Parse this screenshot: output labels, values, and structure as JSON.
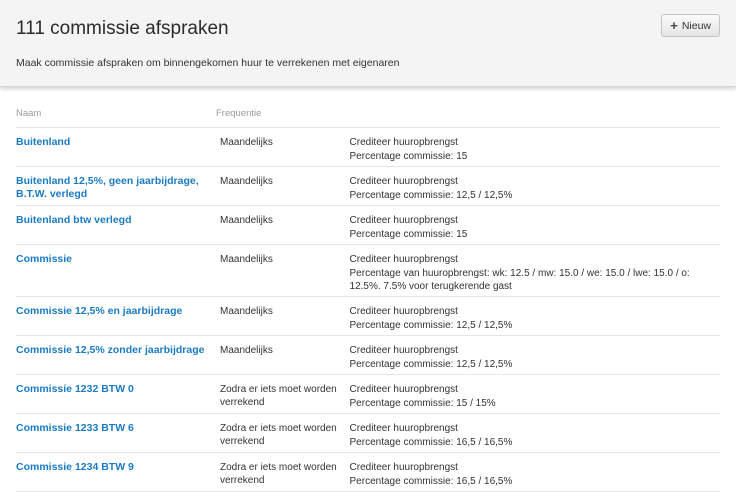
{
  "header": {
    "title": "111 commissie afspraken",
    "subtitle": "Maak commissie afspraken om binnengekomen huur te verrekenen met eigenaren",
    "new_button": {
      "icon": "plus-icon",
      "label": "Nieuw"
    }
  },
  "table": {
    "columns": [
      "Naam",
      "Frequentie",
      ""
    ],
    "rows": [
      {
        "name": "Buitenland",
        "frequency": "Maandelijks",
        "line1": "Crediteer huuropbrengst",
        "line2": "Percentage commissie: 15"
      },
      {
        "name": "Buitenland 12,5%, geen jaarbijdrage, B.T.W. verlegd",
        "frequency": "Maandelijks",
        "line1": "Crediteer huuropbrengst",
        "line2": "Percentage commissie: 12,5 / 12,5%"
      },
      {
        "name": "Buitenland btw verlegd",
        "frequency": "Maandelijks",
        "line1": "Crediteer huuropbrengst",
        "line2": "Percentage commissie: 15"
      },
      {
        "name": "Commissie",
        "frequency": "Maandelijks",
        "line1": "Crediteer huuropbrengst",
        "line2": "Percentage van huuropbrengst: wk: 12.5 / mw: 15.0 / we: 15.0 / lwe: 15.0 / o: 12.5%. 7.5% voor terugkerende gast"
      },
      {
        "name": "Commissie 12,5% en jaarbijdrage",
        "frequency": "Maandelijks",
        "line1": "Crediteer huuropbrengst",
        "line2": "Percentage commissie: 12,5 / 12,5%"
      },
      {
        "name": "Commissie 12,5% zonder jaarbijdrage",
        "frequency": "Maandelijks",
        "line1": "Crediteer huuropbrengst",
        "line2": "Percentage commissie: 12,5 / 12,5%"
      },
      {
        "name": "Commissie 1232 BTW 0",
        "frequency": "Zodra er iets moet worden verrekend",
        "line1": "Crediteer huuropbrengst",
        "line2": "Percentage commissie: 15 / 15%"
      },
      {
        "name": "Commissie 1233 BTW 6",
        "frequency": "Zodra er iets moet worden verrekend",
        "line1": "Crediteer huuropbrengst",
        "line2": "Percentage commissie: 16,5 / 16,5%"
      },
      {
        "name": "Commissie 1234 BTW 9",
        "frequency": "Zodra er iets moet worden verrekend",
        "line1": "Crediteer huuropbrengst",
        "line2": "Percentage commissie: 16,5 / 16,5%"
      }
    ]
  }
}
